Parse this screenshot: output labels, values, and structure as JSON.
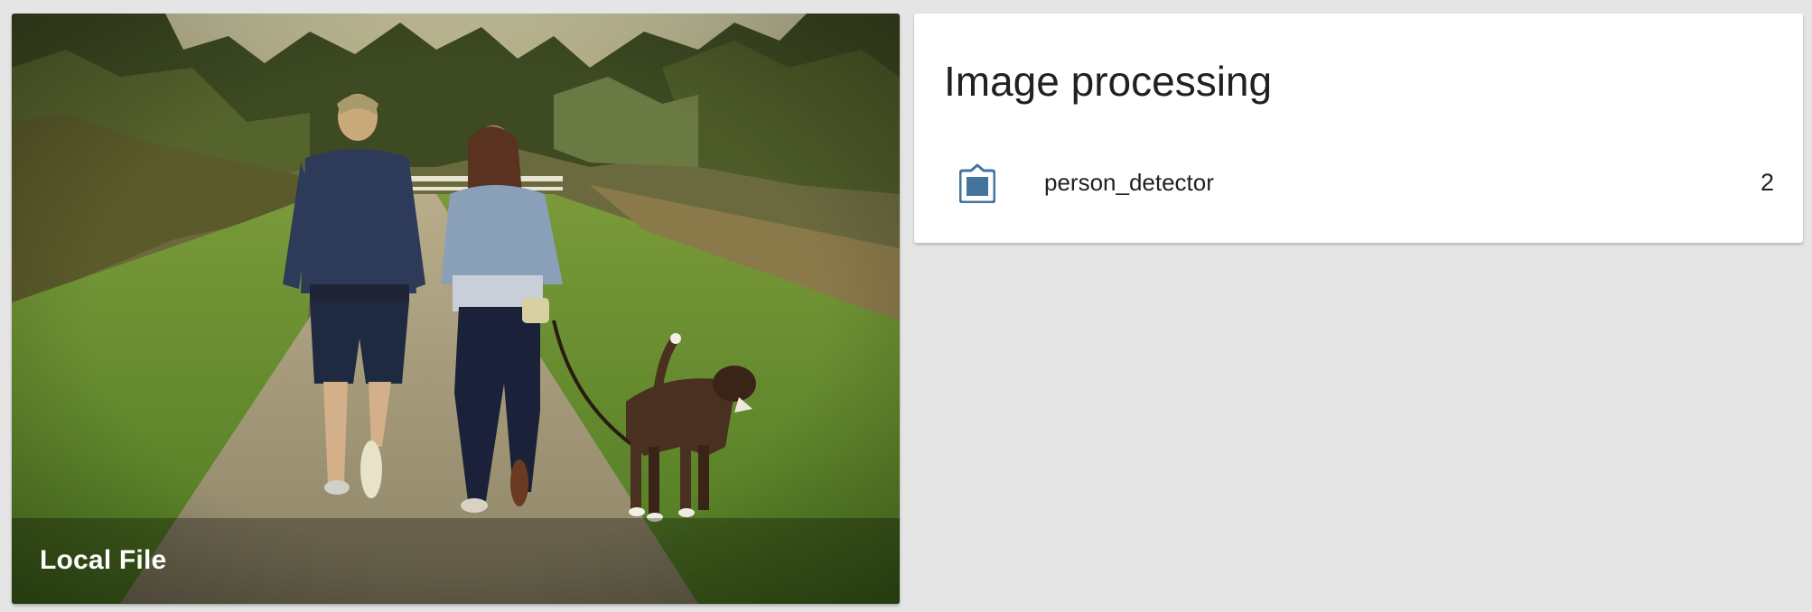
{
  "camera_card": {
    "caption": "Local File",
    "image_subject": "couple-walking-dog-photo"
  },
  "image_processing_card": {
    "title": "Image processing",
    "entities": [
      {
        "name": "person_detector",
        "state": "2",
        "icon": "image-filter-icon",
        "icon_color": "#44739e"
      }
    ]
  },
  "colors": {
    "background": "#e5e5e5",
    "card": "#ffffff",
    "icon": "#44739e",
    "text": "#212121"
  }
}
